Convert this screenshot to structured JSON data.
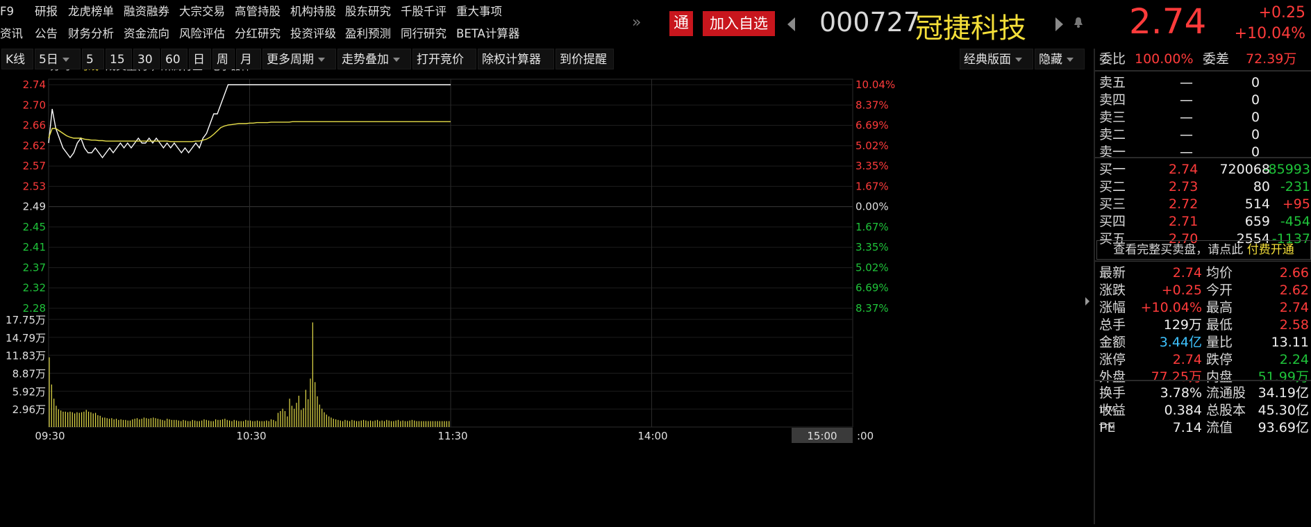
{
  "nav": {
    "row1": [
      "F9",
      "研报",
      "龙虎榜单",
      "融资融券",
      "大宗交易",
      "高管持股",
      "机构持股",
      "股东研究",
      "千股千评",
      "重大事项"
    ],
    "row2": [
      "资讯",
      "公告",
      "财务分析",
      "资金流向",
      "风险评估",
      "分红研究",
      "投资评级",
      "盈利预测",
      "同行研究",
      "BETA计算器"
    ],
    "more": "»"
  },
  "header": {
    "tong": "通",
    "add_fav": "加入自选",
    "code": "000727",
    "name": "冠捷科技",
    "price": "2.74",
    "change": "+0.25",
    "change_pct": "+10.04%"
  },
  "toolbar": {
    "items": [
      "K线",
      "5日",
      "5",
      "15",
      "30",
      "60",
      "日",
      "周",
      "月",
      "更多周期",
      "走势叠加",
      "打开竞价",
      "除权计算器",
      "到价提醒"
    ],
    "right": [
      "经典版面",
      "隐藏"
    ]
  },
  "legend": {
    "items": [
      "分时",
      "均线",
      "成交量(手)",
      "所属行业: 电子器件"
    ]
  },
  "chart_data": {
    "type": "line",
    "prev_close": 2.49,
    "price_ticks": [
      "2.74",
      "2.70",
      "2.66",
      "2.62",
      "2.57",
      "2.53",
      "2.49",
      "2.45",
      "2.41",
      "2.37",
      "2.32",
      "2.28"
    ],
    "pct_ticks": [
      "10.04%",
      "8.37%",
      "6.69%",
      "5.02%",
      "3.35%",
      "1.67%",
      "0.00%",
      "1.67%",
      "3.35%",
      "5.02%",
      "6.69%",
      "8.37%"
    ],
    "vol_ticks": [
      "17.75万",
      "14.79万",
      "11.83万",
      "8.87万",
      "5.92万",
      "2.96万"
    ],
    "time_ticks": [
      "09:30",
      "10:30",
      "11:30",
      "14:00",
      "15:00"
    ],
    "series": [
      {
        "name": "分时",
        "color": "#ffffff",
        "values": [
          2.62,
          2.69,
          2.65,
          2.63,
          2.61,
          2.6,
          2.59,
          2.6,
          2.62,
          2.63,
          2.61,
          2.6,
          2.6,
          2.61,
          2.6,
          2.59,
          2.6,
          2.61,
          2.6,
          2.61,
          2.62,
          2.61,
          2.62,
          2.61,
          2.62,
          2.63,
          2.62,
          2.62,
          2.63,
          2.62,
          2.63,
          2.62,
          2.61,
          2.62,
          2.61,
          2.62,
          2.61,
          2.6,
          2.61,
          2.6,
          2.61,
          2.62,
          2.61,
          2.63,
          2.64,
          2.66,
          2.68,
          2.68,
          2.7,
          2.72,
          2.74,
          2.74,
          2.74,
          2.74,
          2.74,
          2.74,
          2.74,
          2.74,
          2.74,
          2.74,
          2.74,
          2.74,
          2.74,
          2.74,
          2.74,
          2.74,
          2.74,
          2.74,
          2.74,
          2.74,
          2.74
        ]
      },
      {
        "name": "均线",
        "color": "#e8e04a",
        "values": [
          2.63,
          2.65,
          2.65,
          2.645,
          2.64,
          2.635,
          2.632,
          2.63,
          2.63,
          2.63,
          2.628,
          2.627,
          2.626,
          2.626,
          2.625,
          2.625,
          2.624,
          2.624,
          2.624,
          2.624,
          2.624,
          2.624,
          2.624,
          2.624,
          2.624,
          2.624,
          2.624,
          2.624,
          2.624,
          2.624,
          2.624,
          2.624,
          2.624,
          2.624,
          2.623,
          2.623,
          2.623,
          2.623,
          2.623,
          2.623,
          2.623,
          2.624,
          2.624,
          2.626,
          2.628,
          2.632,
          2.638,
          2.645,
          2.652,
          2.655,
          2.657,
          2.658,
          2.659,
          2.66,
          2.66,
          2.66,
          2.661,
          2.661,
          2.662,
          2.662,
          2.662,
          2.662,
          2.663,
          2.663,
          2.663,
          2.663,
          2.663,
          2.663,
          2.664,
          2.664,
          2.664
        ]
      }
    ],
    "volumes": [
      11.8,
      7.2,
      4.8,
      3.6,
      3.0,
      2.8,
      2.6,
      2.6,
      2.5,
      2.6,
      2.5,
      2.3,
      2.5,
      2.4,
      2.5,
      2.6,
      2.9,
      2.6,
      2.5,
      2.3,
      2.4,
      2.0,
      1.9,
      1.6,
      1.6,
      1.5,
      1.4,
      1.5,
      1.3,
      1.4,
      1.2,
      1.3,
      1.2,
      1.2,
      1.1,
      1.1,
      1.3,
      1.4,
      1.5,
      1.3,
      1.4,
      1.6,
      1.5,
      1.4,
      1.5,
      1.6,
      1.5,
      1.4,
      1.3,
      1.2,
      1.1,
      1.4,
      1.3,
      1.2,
      1.2,
      1.2,
      1.1,
      1.0,
      1.2,
      1.1,
      1.0,
      1.0,
      1.2,
      1.1,
      1.0,
      1.0,
      1.1,
      1.3,
      1.2,
      1.1,
      1.0,
      1.0,
      1.3,
      1.2,
      1.2,
      1.3,
      1.4,
      1.2,
      1.1,
      1.0,
      1.2,
      1.1,
      1.0,
      1.0,
      1.0,
      1.2,
      1.1,
      1.1,
      1.0,
      1.0,
      1.1,
      1.0,
      1.0,
      1.0,
      1.1,
      1.0,
      1.3,
      1.2,
      1.0,
      2.4,
      2.7,
      3.1,
      2.7,
      1.8,
      4.8,
      3.6,
      3.1,
      4.1,
      5.3,
      2.9,
      3.2,
      6.3,
      4.7,
      8.2,
      17.7,
      7.6,
      5.2,
      3.8,
      3.1,
      2.5,
      2.1,
      1.8,
      1.6,
      1.4,
      1.3,
      1.2,
      1.1,
      1.0,
      1.2,
      1.1,
      1.0,
      1.2,
      1.1,
      1.0,
      1.0,
      1.1,
      1.2,
      1.1,
      1.0,
      1.1,
      1.0,
      1.1,
      1.2,
      1.0,
      1.1,
      1.0,
      1.2,
      1.1,
      1.0,
      1.0,
      1.1,
      1.2,
      1.0,
      1.1,
      1.0,
      1.0,
      1.1,
      1.2,
      1.1,
      1.0,
      1.0,
      1.0,
      1.0,
      1.0,
      1.0,
      1.0,
      1.0,
      1.0,
      1.0,
      1.0,
      1.0,
      1.0,
      1.0,
      1.0
    ]
  },
  "sidebar": {
    "weibi_label": "委比",
    "weibi": "100.00%",
    "weicha_label": "委差",
    "weicha": "72.39万",
    "sell": [
      {
        "label": "卖五",
        "price": "—",
        "vol": "0"
      },
      {
        "label": "卖四",
        "price": "—",
        "vol": "0"
      },
      {
        "label": "卖三",
        "price": "—",
        "vol": "0"
      },
      {
        "label": "卖二",
        "price": "—",
        "vol": "0"
      },
      {
        "label": "卖一",
        "price": "—",
        "vol": "0"
      }
    ],
    "buy": [
      {
        "label": "买一",
        "price": "2.74",
        "vol": "720068",
        "delta": "-85993",
        "dcolor": "green"
      },
      {
        "label": "买二",
        "price": "2.73",
        "vol": "80",
        "delta": "-231",
        "dcolor": "green"
      },
      {
        "label": "买三",
        "price": "2.72",
        "vol": "514",
        "delta": "+95",
        "dcolor": "red"
      },
      {
        "label": "买四",
        "price": "2.71",
        "vol": "659",
        "delta": "-454",
        "dcolor": "green"
      },
      {
        "label": "买五",
        "price": "2.70",
        "vol": "2554",
        "delta": "-1137",
        "dcolor": "green"
      }
    ],
    "vip_text": "查看完整买卖盘，请点此",
    "vip_link": "付费开通",
    "stats": [
      {
        "l1": "最新",
        "v1": "2.74",
        "c1": "red",
        "l2": "均价",
        "v2": "2.66",
        "c2": "red"
      },
      {
        "l1": "涨跌",
        "v1": "+0.25",
        "c1": "red",
        "l2": "今开",
        "v2": "2.62",
        "c2": "red"
      },
      {
        "l1": "涨幅",
        "v1": "+10.04%",
        "c1": "red",
        "l2": "最高",
        "v2": "2.74",
        "c2": "red"
      },
      {
        "l1": "总手",
        "v1": "129万",
        "c1": "white",
        "l2": "最低",
        "v2": "2.58",
        "c2": "red"
      },
      {
        "l1": "金额",
        "v1": "3.44亿",
        "c1": "blue",
        "l2": "量比",
        "v2": "13.11",
        "c2": "white"
      },
      {
        "l1": "涨停",
        "v1": "2.74",
        "c1": "red",
        "l2": "跌停",
        "v2": "2.24",
        "c2": "green"
      },
      {
        "l1": "外盘",
        "v1": "77.25万",
        "c1": "red",
        "l2": "内盘",
        "v2": "51.99万",
        "c2": "green"
      }
    ],
    "stats2": [
      {
        "l1": "换手",
        "v1": "3.78%",
        "l2": "流通股",
        "v2": "34.19亿"
      },
      {
        "l1": "收益",
        "sup1": "TTM",
        "v1": "0.384",
        "l2": "总股本",
        "v2": "45.30亿"
      },
      {
        "l1": "PE",
        "sup1": "TTM",
        "v1": "7.14",
        "l2": "流值",
        "v2": "93.69亿"
      }
    ]
  }
}
